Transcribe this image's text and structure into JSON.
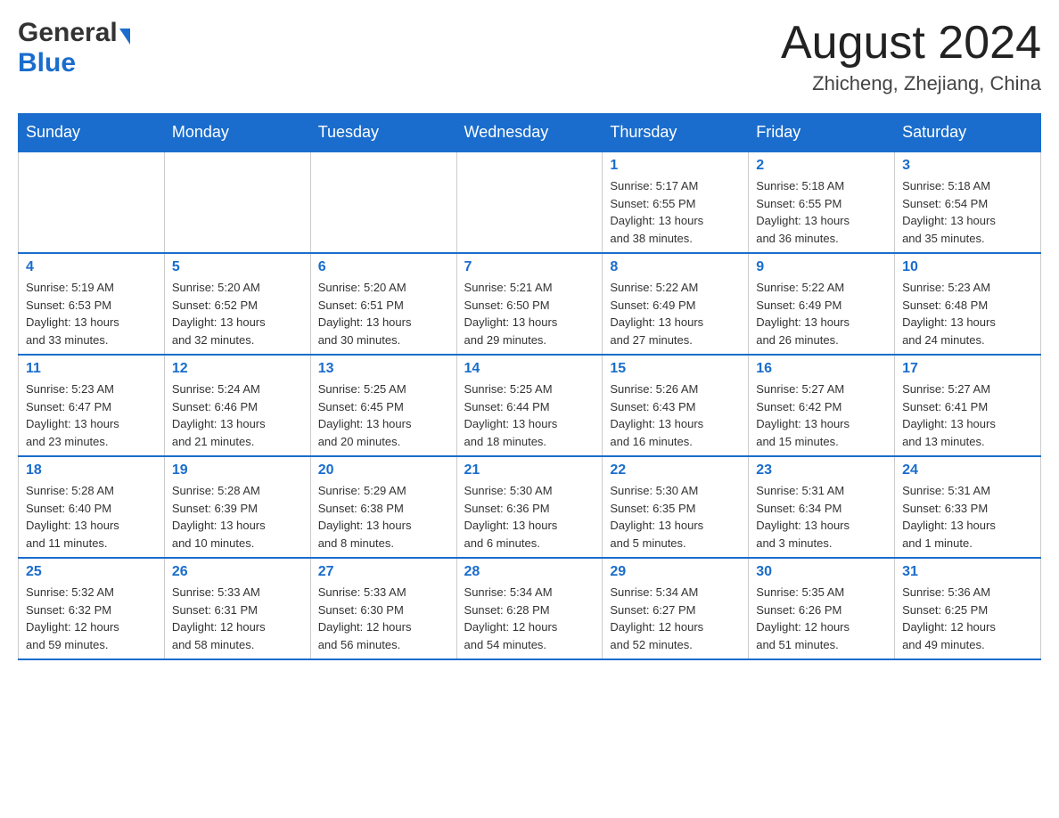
{
  "header": {
    "logo_general": "General",
    "logo_blue": "Blue",
    "title": "August 2024",
    "subtitle": "Zhicheng, Zhejiang, China"
  },
  "weekdays": [
    "Sunday",
    "Monday",
    "Tuesday",
    "Wednesday",
    "Thursday",
    "Friday",
    "Saturday"
  ],
  "weeks": [
    [
      {
        "day": "",
        "info": ""
      },
      {
        "day": "",
        "info": ""
      },
      {
        "day": "",
        "info": ""
      },
      {
        "day": "",
        "info": ""
      },
      {
        "day": "1",
        "info": "Sunrise: 5:17 AM\nSunset: 6:55 PM\nDaylight: 13 hours\nand 38 minutes."
      },
      {
        "day": "2",
        "info": "Sunrise: 5:18 AM\nSunset: 6:55 PM\nDaylight: 13 hours\nand 36 minutes."
      },
      {
        "day": "3",
        "info": "Sunrise: 5:18 AM\nSunset: 6:54 PM\nDaylight: 13 hours\nand 35 minutes."
      }
    ],
    [
      {
        "day": "4",
        "info": "Sunrise: 5:19 AM\nSunset: 6:53 PM\nDaylight: 13 hours\nand 33 minutes."
      },
      {
        "day": "5",
        "info": "Sunrise: 5:20 AM\nSunset: 6:52 PM\nDaylight: 13 hours\nand 32 minutes."
      },
      {
        "day": "6",
        "info": "Sunrise: 5:20 AM\nSunset: 6:51 PM\nDaylight: 13 hours\nand 30 minutes."
      },
      {
        "day": "7",
        "info": "Sunrise: 5:21 AM\nSunset: 6:50 PM\nDaylight: 13 hours\nand 29 minutes."
      },
      {
        "day": "8",
        "info": "Sunrise: 5:22 AM\nSunset: 6:49 PM\nDaylight: 13 hours\nand 27 minutes."
      },
      {
        "day": "9",
        "info": "Sunrise: 5:22 AM\nSunset: 6:49 PM\nDaylight: 13 hours\nand 26 minutes."
      },
      {
        "day": "10",
        "info": "Sunrise: 5:23 AM\nSunset: 6:48 PM\nDaylight: 13 hours\nand 24 minutes."
      }
    ],
    [
      {
        "day": "11",
        "info": "Sunrise: 5:23 AM\nSunset: 6:47 PM\nDaylight: 13 hours\nand 23 minutes."
      },
      {
        "day": "12",
        "info": "Sunrise: 5:24 AM\nSunset: 6:46 PM\nDaylight: 13 hours\nand 21 minutes."
      },
      {
        "day": "13",
        "info": "Sunrise: 5:25 AM\nSunset: 6:45 PM\nDaylight: 13 hours\nand 20 minutes."
      },
      {
        "day": "14",
        "info": "Sunrise: 5:25 AM\nSunset: 6:44 PM\nDaylight: 13 hours\nand 18 minutes."
      },
      {
        "day": "15",
        "info": "Sunrise: 5:26 AM\nSunset: 6:43 PM\nDaylight: 13 hours\nand 16 minutes."
      },
      {
        "day": "16",
        "info": "Sunrise: 5:27 AM\nSunset: 6:42 PM\nDaylight: 13 hours\nand 15 minutes."
      },
      {
        "day": "17",
        "info": "Sunrise: 5:27 AM\nSunset: 6:41 PM\nDaylight: 13 hours\nand 13 minutes."
      }
    ],
    [
      {
        "day": "18",
        "info": "Sunrise: 5:28 AM\nSunset: 6:40 PM\nDaylight: 13 hours\nand 11 minutes."
      },
      {
        "day": "19",
        "info": "Sunrise: 5:28 AM\nSunset: 6:39 PM\nDaylight: 13 hours\nand 10 minutes."
      },
      {
        "day": "20",
        "info": "Sunrise: 5:29 AM\nSunset: 6:38 PM\nDaylight: 13 hours\nand 8 minutes."
      },
      {
        "day": "21",
        "info": "Sunrise: 5:30 AM\nSunset: 6:36 PM\nDaylight: 13 hours\nand 6 minutes."
      },
      {
        "day": "22",
        "info": "Sunrise: 5:30 AM\nSunset: 6:35 PM\nDaylight: 13 hours\nand 5 minutes."
      },
      {
        "day": "23",
        "info": "Sunrise: 5:31 AM\nSunset: 6:34 PM\nDaylight: 13 hours\nand 3 minutes."
      },
      {
        "day": "24",
        "info": "Sunrise: 5:31 AM\nSunset: 6:33 PM\nDaylight: 13 hours\nand 1 minute."
      }
    ],
    [
      {
        "day": "25",
        "info": "Sunrise: 5:32 AM\nSunset: 6:32 PM\nDaylight: 12 hours\nand 59 minutes."
      },
      {
        "day": "26",
        "info": "Sunrise: 5:33 AM\nSunset: 6:31 PM\nDaylight: 12 hours\nand 58 minutes."
      },
      {
        "day": "27",
        "info": "Sunrise: 5:33 AM\nSunset: 6:30 PM\nDaylight: 12 hours\nand 56 minutes."
      },
      {
        "day": "28",
        "info": "Sunrise: 5:34 AM\nSunset: 6:28 PM\nDaylight: 12 hours\nand 54 minutes."
      },
      {
        "day": "29",
        "info": "Sunrise: 5:34 AM\nSunset: 6:27 PM\nDaylight: 12 hours\nand 52 minutes."
      },
      {
        "day": "30",
        "info": "Sunrise: 5:35 AM\nSunset: 6:26 PM\nDaylight: 12 hours\nand 51 minutes."
      },
      {
        "day": "31",
        "info": "Sunrise: 5:36 AM\nSunset: 6:25 PM\nDaylight: 12 hours\nand 49 minutes."
      }
    ]
  ]
}
